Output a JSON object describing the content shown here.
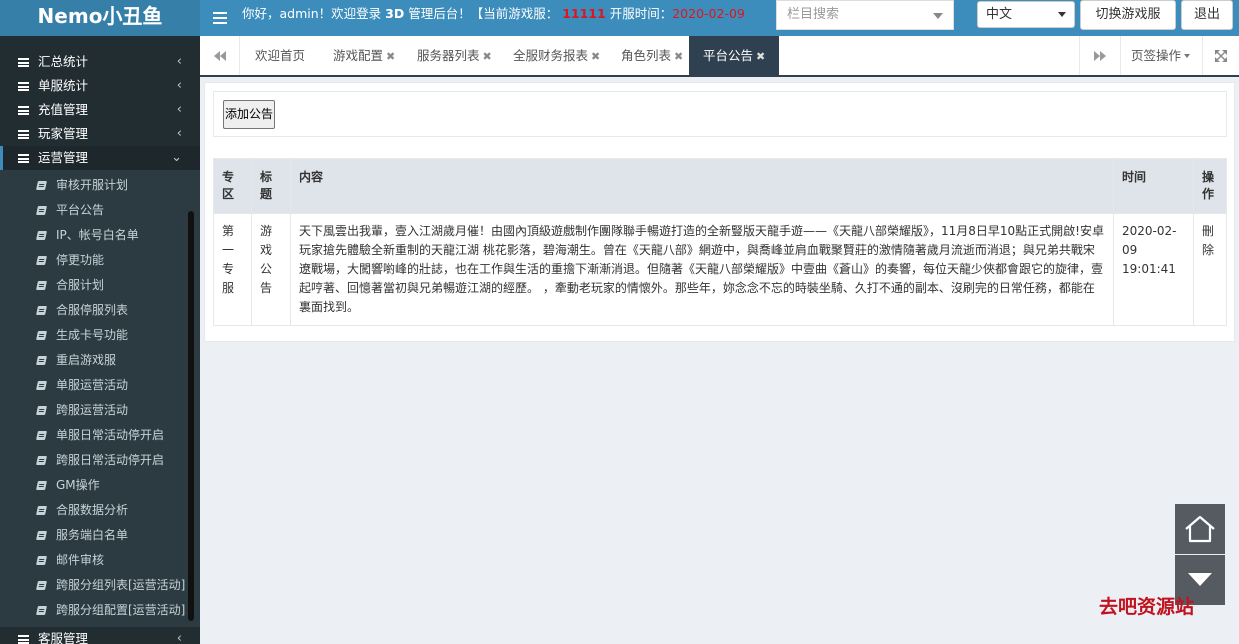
{
  "app": {
    "logo": "Nemo小丑鱼",
    "welcome_prefix": "你好，admin！欢迎登录",
    "welcome_3d": "3D",
    "welcome_mid": "管理后台！【当前游戏服：",
    "server_id": "11111",
    "welcome_open": "开服时间：",
    "open_time": "2020-02-09"
  },
  "header": {
    "search_placeholder": "栏目搜索",
    "language": "中文",
    "switch_label": "切换游戏服",
    "logout_label": "退出"
  },
  "sidebar": {
    "items": [
      {
        "label": "汇总统计"
      },
      {
        "label": "单服统计"
      },
      {
        "label": "充值管理"
      },
      {
        "label": "玩家管理"
      },
      {
        "label": "运营管理"
      }
    ],
    "sub_items": [
      {
        "label": "审核开服计划"
      },
      {
        "label": "平台公告"
      },
      {
        "label": "IP、帐号白名单"
      },
      {
        "label": "停更功能"
      },
      {
        "label": "合服计划"
      },
      {
        "label": "合服停服列表"
      },
      {
        "label": "生成卡号功能"
      },
      {
        "label": "重启游戏服"
      },
      {
        "label": "单服运营活动"
      },
      {
        "label": "跨服运营活动"
      },
      {
        "label": "单服日常活动停开启"
      },
      {
        "label": "跨服日常活动停开启"
      },
      {
        "label": "GM操作"
      },
      {
        "label": "合服数据分析"
      },
      {
        "label": "服务端白名单"
      },
      {
        "label": "邮件审核"
      },
      {
        "label": "跨服分组列表[运营活动]"
      },
      {
        "label": "跨服分组配置[运营活动]"
      }
    ],
    "bottom_item": "客服管理"
  },
  "tabs": {
    "items": [
      {
        "label": "欢迎首页"
      },
      {
        "label": "游戏配置"
      },
      {
        "label": "服务器列表"
      },
      {
        "label": "全服财务报表"
      },
      {
        "label": "角色列表"
      },
      {
        "label": "平台公告"
      }
    ],
    "ops_label": "页签操作"
  },
  "content": {
    "add_button": "添加公告",
    "table": {
      "headers": [
        "专区",
        "标题",
        "内容",
        "时间",
        "操作"
      ],
      "rows": [
        {
          "zone": "第一专服",
          "title": "游戏公告",
          "content": "天下風雲出我輩，壹入江湖歲月催！由國內頂級遊戲制作團隊聯手暢遊打造的全新豎版天龍手遊——《天龍八部榮耀版》，11月8日早10點正式開啟!安卓玩家搶先體驗全新重制的天龍江湖 桃花影落，碧海潮生。曾在《天龍八部》網遊中，與喬峰並肩血戰聚賢莊的激情隨著歲月流逝而消退；與兄弟共戰宋遼戰場，大闖響喲峰的壯誌，也在工作與生活的重擔下漸漸消退。但隨著《天龍八部榮耀版》中壹曲《蒼山》的奏響，每位天龍少俠都會跟它的旋律，壹起哼著、回憶著當初與兄弟暢遊江湖的經歷。 ，牽動老玩家的情懷外。那些年，妳念念不忘的時裝坐騎、久打不通的副本、沒刷完的日常任務，都能在裏面找到。",
          "time": "2020-02-09 19:01:41",
          "op": "刪除"
        }
      ]
    }
  },
  "watermark": "去吧资源站"
}
